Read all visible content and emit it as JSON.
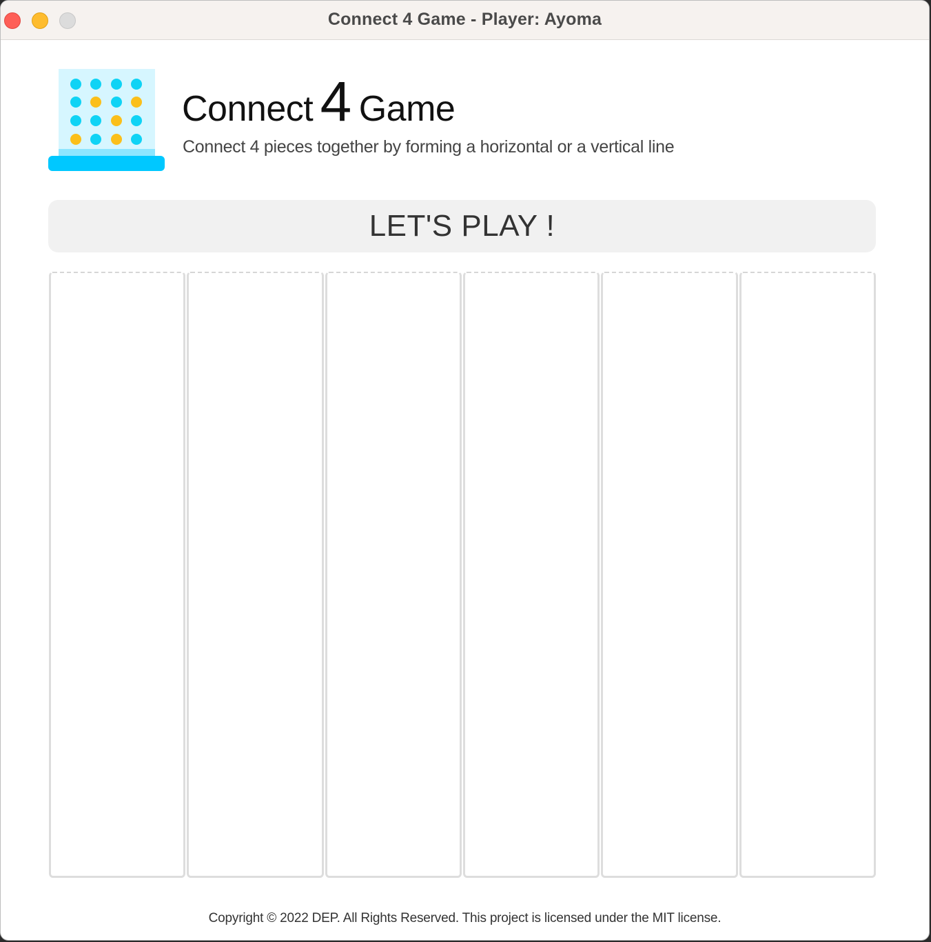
{
  "window": {
    "title": "Connect 4 Game - Player: Ayoma"
  },
  "logo": {
    "icon": "connect-four-board-icon",
    "colors": {
      "frame": "#d6f6ff",
      "base": "#00c8ff",
      "base_highlight": "#8de6ff",
      "cyan_disc": "#0fd3f5",
      "yellow_disc": "#fbbf1a"
    }
  },
  "header": {
    "title_part1": "Connect",
    "title_number": "4",
    "title_part2": "Game",
    "subtitle": "Connect 4 pieces together by forming a horizontal or a vertical line"
  },
  "play_button": {
    "label": "LET'S PLAY !"
  },
  "board": {
    "columns": 6
  },
  "footer": {
    "text": "Copyright © 2022 DEP. All Rights Reserved. This project is licensed under the MIT license."
  }
}
